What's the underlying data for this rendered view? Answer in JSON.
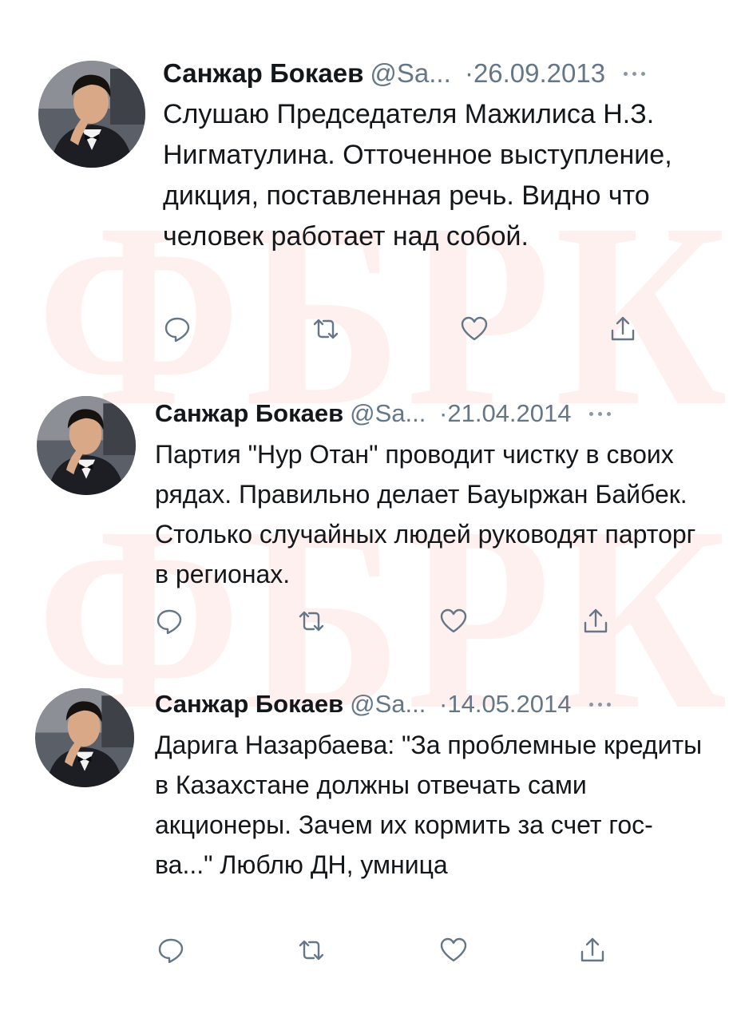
{
  "watermark_text": "ФБРК",
  "icons": {
    "reply": "reply-icon",
    "retweet": "retweet-icon",
    "like": "heart-icon",
    "share": "share-icon",
    "more": "more-dots-icon"
  },
  "tweets": [
    {
      "author_name": "Санжар Бокаев",
      "handle": "@Sa...",
      "separator": "·",
      "date": "26.09.2013",
      "text": "Слушаю Председателя Мажилиса Н.З. Нигматулина. Отточенное выступление, дикция, поставленная речь. Видно что человек работает над собой."
    },
    {
      "author_name": "Санжар Бокаев",
      "handle": "@Sa...",
      "separator": "·",
      "date": "21.04.2014",
      "text": "Партия \"Нур Отан\" проводит чистку в своих рядах. Правильно делает Бауыржан Байбек. Столько случайных людей руководят парторг в регионах."
    },
    {
      "author_name": "Санжар Бокаев",
      "handle": "@Sa...",
      "separator": "·",
      "date": "14.05.2014",
      "text": "Дарига Назарбаева: \"За проблемные кредиты в Казахстане должны отвечать сами акционеры. Зачем их кормить за счет гос-ва...\" Люблю ДН, умница"
    }
  ]
}
